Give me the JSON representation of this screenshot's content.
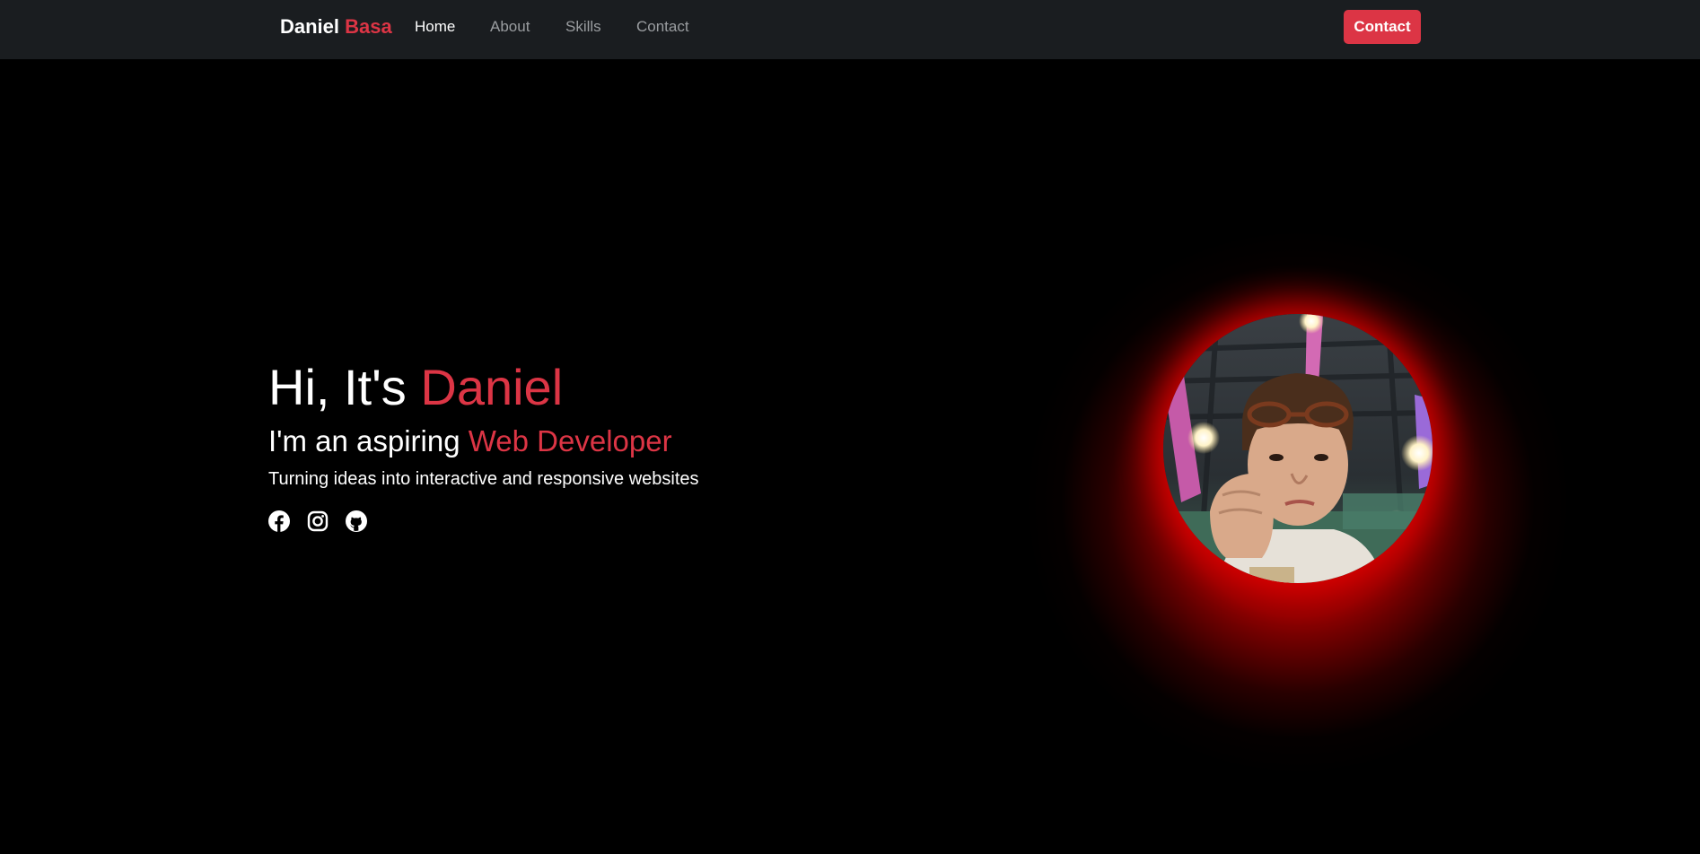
{
  "navbar": {
    "brand_first": "Daniel",
    "brand_last": "Basa",
    "links": [
      {
        "label": "Home",
        "active": true
      },
      {
        "label": "About",
        "active": false
      },
      {
        "label": "Skills",
        "active": false
      },
      {
        "label": "Contact",
        "active": false
      }
    ],
    "contact_button": "Contact"
  },
  "hero": {
    "greeting": "Hi, It's",
    "name": "Daniel",
    "role_prefix": "I'm an aspiring",
    "role": "Web Developer",
    "tagline": "Turning ideas into interactive and responsive websites",
    "social": [
      {
        "icon": "facebook-icon"
      },
      {
        "icon": "instagram-icon"
      },
      {
        "icon": "github-icon"
      }
    ]
  },
  "colors": {
    "accent": "#dc3545",
    "navbar_bg": "#1a1d20",
    "page_bg": "#000000",
    "glow": "#d00000"
  }
}
